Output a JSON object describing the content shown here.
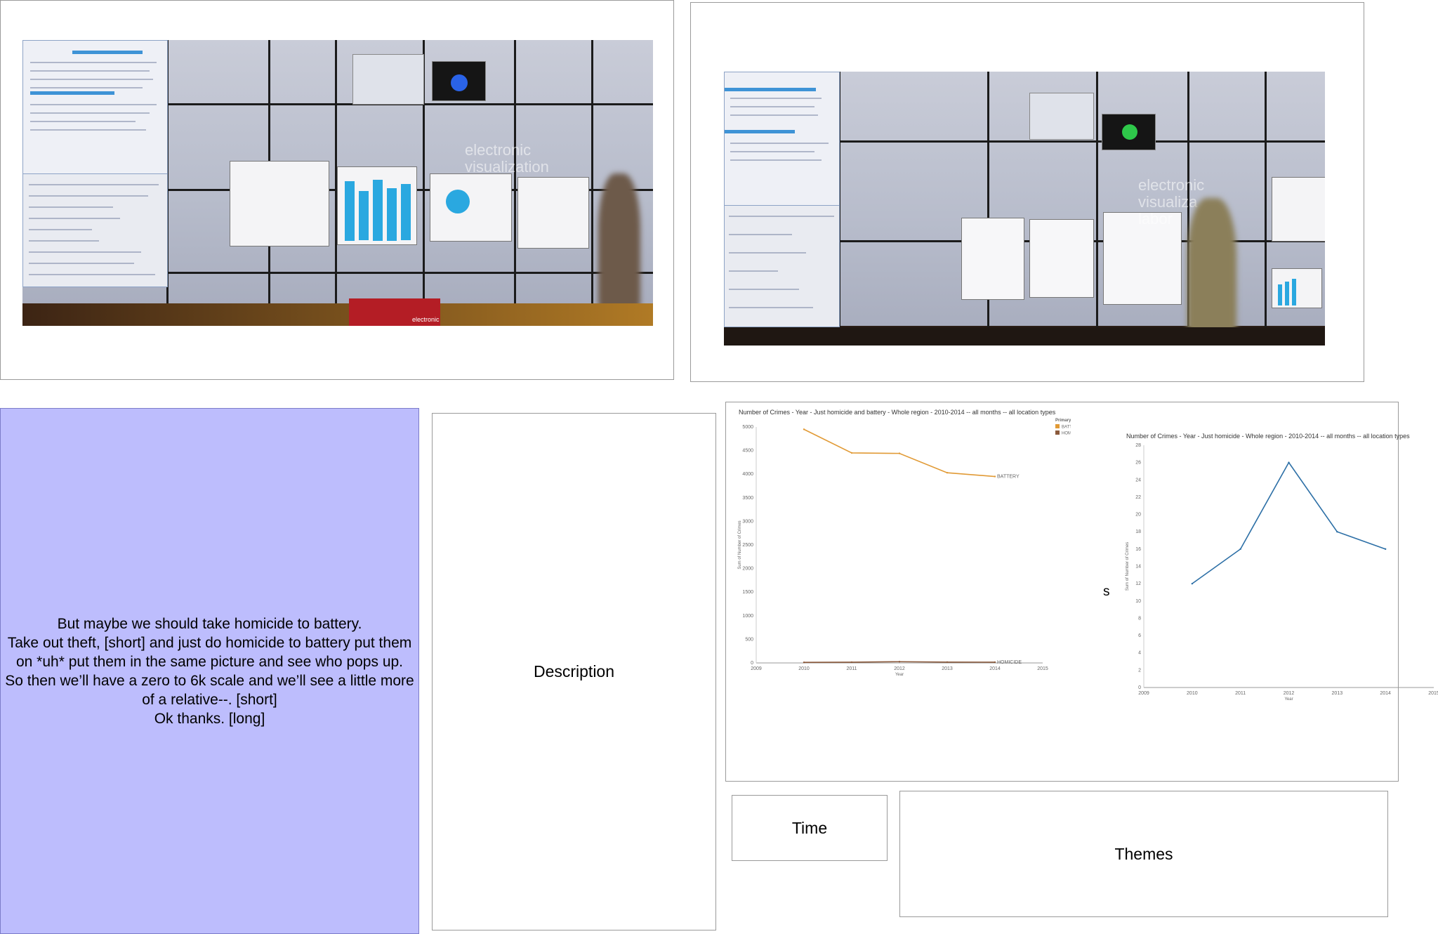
{
  "transcript": {
    "lines": [
      "But maybe we should take homicide to battery.",
      "Take out theft, [short] and just do homicide to battery put them on *uh* put them in the same picture and see who pops up.",
      "So then we’ll have a zero to 6k scale and we’ll see a little more of a relative--. [short]",
      "Ok thanks. [long]"
    ]
  },
  "labels": {
    "description": "Description",
    "time": "Time",
    "themes": "Themes",
    "separator": "s"
  },
  "colors": {
    "transcript_bg": "#bdbdfd",
    "battery": "#e19a35",
    "homicide": "#8b5a3c",
    "homicide_only": "#2c6fa6"
  },
  "photos": {
    "left": {
      "wall_text": [
        "electronic",
        "visualization"
      ],
      "floor_sign": "electronic"
    },
    "right": {
      "wall_text": [
        "electronic",
        "visualiza",
        "labor"
      ]
    }
  },
  "charts": {
    "chart1": {
      "title": "Number of Crimes - Year - Just homicide and battery - Whole region - 2010-2014 -- all months -- all location types",
      "legend_title": "Primary Type",
      "legend_items": [
        "BATTERY",
        "HOMICIDE"
      ],
      "ylabel": "Sum of Number of Crimes",
      "xlabel": "Year",
      "yticks": [
        "5000",
        "4500",
        "4000",
        "3500",
        "3000",
        "2500",
        "2000",
        "1500",
        "1000",
        "500",
        "0"
      ],
      "xticks": [
        "2009",
        "2010",
        "2011",
        "2012",
        "2013",
        "2014",
        "2015"
      ],
      "line_labels": [
        "BATTERY",
        "HOMICIDE"
      ]
    },
    "chart2": {
      "title": "Number of Crimes - Year - Just homicide - Whole region - 2010-2014 -- all months -- all location types",
      "ylabel": "Sum of Number of Crimes",
      "xlabel": "Year",
      "yticks": [
        "28",
        "26",
        "24",
        "22",
        "20",
        "18",
        "16",
        "14",
        "12",
        "10",
        "8",
        "6",
        "4",
        "2",
        "0"
      ],
      "xticks": [
        "2009",
        "2010",
        "2011",
        "2012",
        "2013",
        "2014",
        "2015"
      ]
    }
  },
  "chart_data": [
    {
      "type": "line",
      "title": "Number of Crimes - Year - Just homicide and battery - Whole region - 2010-2014 -- all months -- all location types",
      "x": [
        2010,
        2011,
        2012,
        2013,
        2014
      ],
      "series": [
        {
          "name": "BATTERY",
          "values": [
            4950,
            4450,
            4440,
            4030,
            3950
          ]
        },
        {
          "name": "HOMICIDE",
          "values": [
            12,
            16,
            26,
            18,
            16
          ]
        }
      ],
      "xlabel": "Year",
      "ylabel": "Sum of Number of Crimes",
      "xlim": [
        2009,
        2015
      ],
      "ylim": [
        0,
        5000
      ],
      "legend": "top-right"
    },
    {
      "type": "line",
      "title": "Number of Crimes - Year - Just homicide - Whole region - 2010-2014 -- all months -- all location types",
      "x": [
        2010,
        2011,
        2012,
        2013,
        2014
      ],
      "series": [
        {
          "values": [
            12,
            16,
            26,
            18,
            16
          ]
        }
      ],
      "xlabel": "Year",
      "ylabel": "Sum of Number of Crimes",
      "xlim": [
        2009,
        2015
      ],
      "ylim": [
        0,
        28
      ]
    }
  ]
}
